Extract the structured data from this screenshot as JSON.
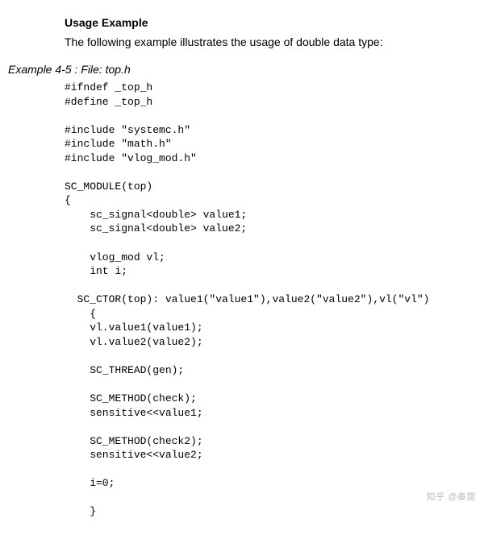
{
  "heading": "Usage Example",
  "description": "The following example illustrates the usage of double data type:",
  "example_label": "Example 4-5   : File: top.h",
  "code": "#ifndef _top_h\n#define _top_h\n\n#include \"systemc.h\"\n#include \"math.h\"\n#include \"vlog_mod.h\"\n\nSC_MODULE(top)\n{\n    sc_signal<double> value1;\n    sc_signal<double> value2;\n\n    vlog_mod vl;\n    int i;\n\n  SC_CTOR(top): value1(\"value1\"),value2(\"value2\"),vl(\"vl\")\n    {\n    vl.value1(value1);\n    vl.value2(value2);\n\n    SC_THREAD(gen);\n\n    SC_METHOD(check);\n    sensitive<<value1;\n\n    SC_METHOD(check2);\n    sensitive<<value2;\n\n    i=0;\n\n    }",
  "watermark": "知乎 @秦旋"
}
